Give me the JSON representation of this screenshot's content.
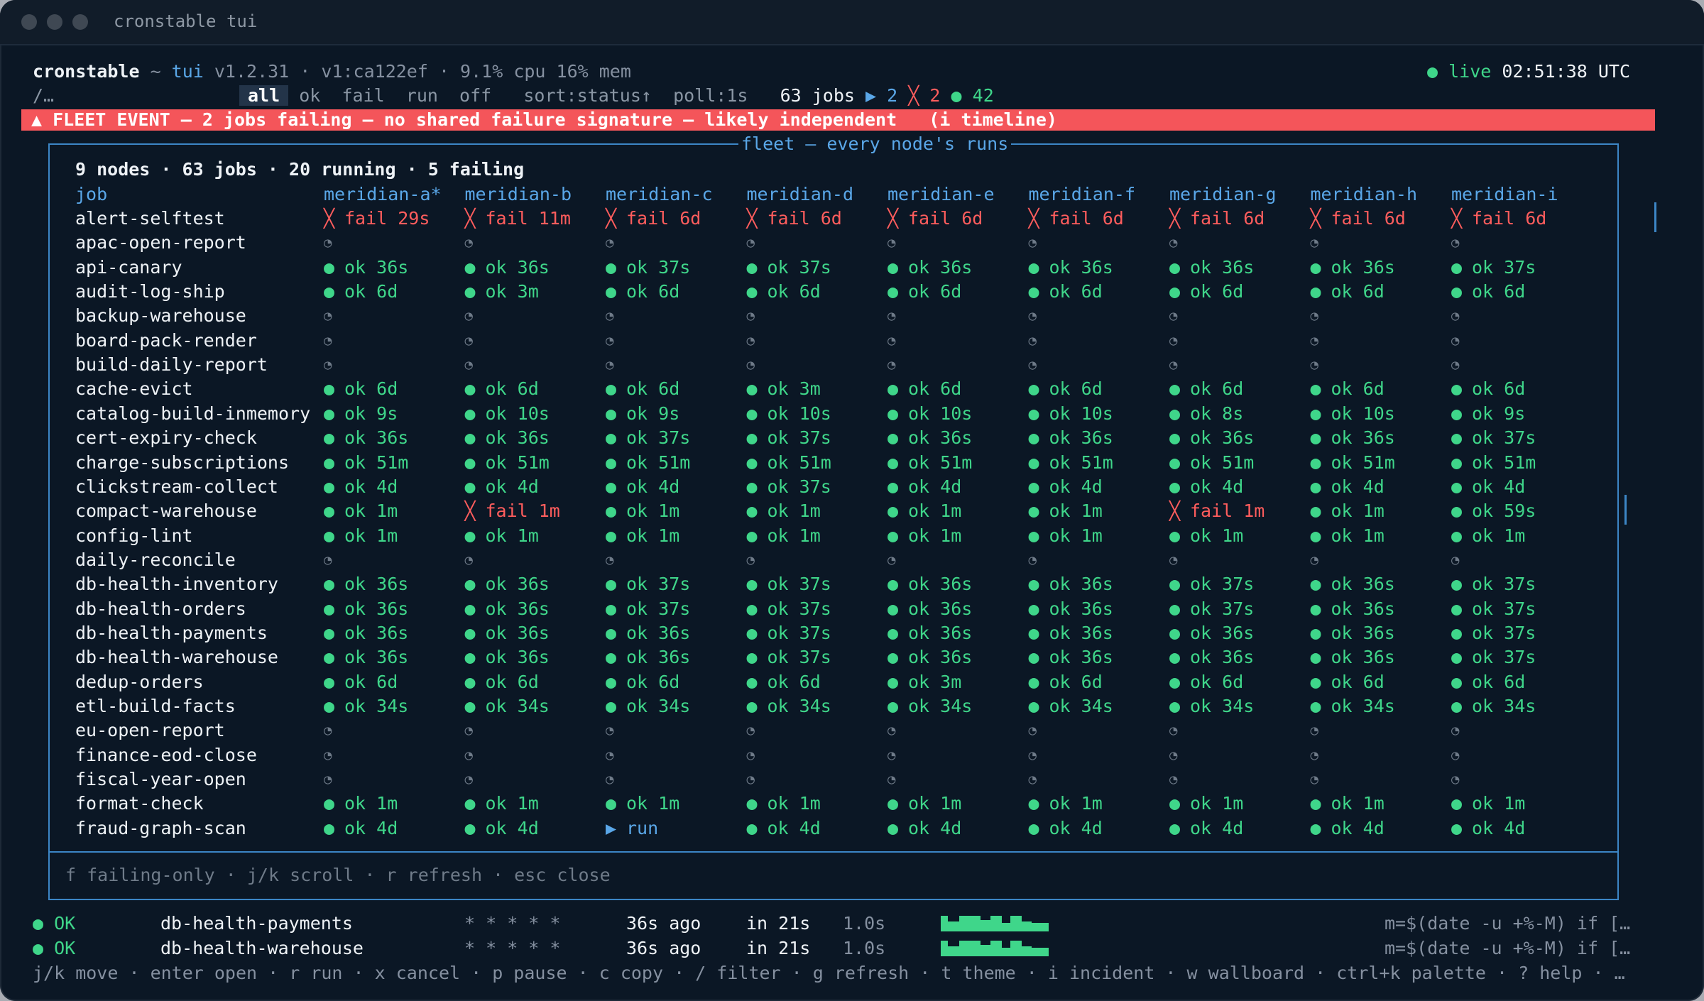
{
  "window": {
    "title": "cronstable tui"
  },
  "header": {
    "app": "cronstable",
    "sep": " ~ ",
    "mode": "tui",
    "meta": " v1.2.31 · v1:ca122ef · 9.1% cpu 16% mem",
    "live_label": "live",
    "clock": "02:51:38 UTC",
    "path": "/…",
    "filters": [
      "all",
      "ok",
      "fail",
      "run",
      "off"
    ],
    "active_filter": "all",
    "sort": "sort:status↑",
    "poll": "poll:1s",
    "jobs_count": "63 jobs",
    "run_count": "2",
    "fail_count": "2",
    "ok_count": "42"
  },
  "banner": {
    "text": "▲ FLEET EVENT — 2 jobs failing — no shared failure signature — likely independent   (i timeline)"
  },
  "fleet": {
    "title": "fleet — every node's runs",
    "summary": "9 nodes · 63 jobs · 20 running · 5 failing",
    "job_header": "job",
    "nodes": [
      "meridian-a*",
      "meridian-b",
      "meridian-c",
      "meridian-d",
      "meridian-e",
      "meridian-f",
      "meridian-g",
      "meridian-h",
      "meridian-i"
    ],
    "rows": [
      {
        "job": "alert-selftest",
        "cells": [
          [
            "fail",
            "fail 29s"
          ],
          [
            "fail",
            "fail 11m"
          ],
          [
            "fail",
            "fail 6d"
          ],
          [
            "fail",
            "fail 6d"
          ],
          [
            "fail",
            "fail 6d"
          ],
          [
            "fail",
            "fail 6d"
          ],
          [
            "fail",
            "fail 6d"
          ],
          [
            "fail",
            "fail 6d"
          ],
          [
            "fail",
            "fail 6d"
          ]
        ]
      },
      {
        "job": "apac-open-report",
        "cells": [
          [
            "idle",
            ""
          ],
          [
            "idle",
            ""
          ],
          [
            "idle",
            ""
          ],
          [
            "idle",
            ""
          ],
          [
            "idle",
            ""
          ],
          [
            "idle",
            ""
          ],
          [
            "idle",
            ""
          ],
          [
            "idle",
            ""
          ],
          [
            "idle",
            ""
          ]
        ]
      },
      {
        "job": "api-canary",
        "cells": [
          [
            "ok",
            "ok 36s"
          ],
          [
            "ok",
            "ok 36s"
          ],
          [
            "ok",
            "ok 37s"
          ],
          [
            "ok",
            "ok 37s"
          ],
          [
            "ok",
            "ok 36s"
          ],
          [
            "ok",
            "ok 36s"
          ],
          [
            "ok",
            "ok 36s"
          ],
          [
            "ok",
            "ok 36s"
          ],
          [
            "ok",
            "ok 37s"
          ]
        ]
      },
      {
        "job": "audit-log-ship",
        "cells": [
          [
            "ok",
            "ok 6d"
          ],
          [
            "ok",
            "ok 3m"
          ],
          [
            "ok",
            "ok 6d"
          ],
          [
            "ok",
            "ok 6d"
          ],
          [
            "ok",
            "ok 6d"
          ],
          [
            "ok",
            "ok 6d"
          ],
          [
            "ok",
            "ok 6d"
          ],
          [
            "ok",
            "ok 6d"
          ],
          [
            "ok",
            "ok 6d"
          ]
        ]
      },
      {
        "job": "backup-warehouse",
        "cells": [
          [
            "idle",
            ""
          ],
          [
            "idle",
            ""
          ],
          [
            "idle",
            ""
          ],
          [
            "idle",
            ""
          ],
          [
            "idle",
            ""
          ],
          [
            "idle",
            ""
          ],
          [
            "idle",
            ""
          ],
          [
            "idle",
            ""
          ],
          [
            "idle",
            ""
          ]
        ]
      },
      {
        "job": "board-pack-render",
        "cells": [
          [
            "idle",
            ""
          ],
          [
            "idle",
            ""
          ],
          [
            "idle",
            ""
          ],
          [
            "idle",
            ""
          ],
          [
            "idle",
            ""
          ],
          [
            "idle",
            ""
          ],
          [
            "idle",
            ""
          ],
          [
            "idle",
            ""
          ],
          [
            "idle",
            ""
          ]
        ]
      },
      {
        "job": "build-daily-report",
        "cells": [
          [
            "idle",
            ""
          ],
          [
            "idle",
            ""
          ],
          [
            "idle",
            ""
          ],
          [
            "idle",
            ""
          ],
          [
            "idle",
            ""
          ],
          [
            "idle",
            ""
          ],
          [
            "idle",
            ""
          ],
          [
            "idle",
            ""
          ],
          [
            "idle",
            ""
          ]
        ]
      },
      {
        "job": "cache-evict",
        "cells": [
          [
            "ok",
            "ok 6d"
          ],
          [
            "ok",
            "ok 6d"
          ],
          [
            "ok",
            "ok 6d"
          ],
          [
            "ok",
            "ok 3m"
          ],
          [
            "ok",
            "ok 6d"
          ],
          [
            "ok",
            "ok 6d"
          ],
          [
            "ok",
            "ok 6d"
          ],
          [
            "ok",
            "ok 6d"
          ],
          [
            "ok",
            "ok 6d"
          ]
        ]
      },
      {
        "job": "catalog-build-inmemory",
        "cells": [
          [
            "ok",
            "ok 9s"
          ],
          [
            "ok",
            "ok 10s"
          ],
          [
            "ok",
            "ok 9s"
          ],
          [
            "ok",
            "ok 10s"
          ],
          [
            "ok",
            "ok 10s"
          ],
          [
            "ok",
            "ok 10s"
          ],
          [
            "ok",
            "ok 8s"
          ],
          [
            "ok",
            "ok 10s"
          ],
          [
            "ok",
            "ok 9s"
          ]
        ]
      },
      {
        "job": "cert-expiry-check",
        "cells": [
          [
            "ok",
            "ok 36s"
          ],
          [
            "ok",
            "ok 36s"
          ],
          [
            "ok",
            "ok 37s"
          ],
          [
            "ok",
            "ok 37s"
          ],
          [
            "ok",
            "ok 36s"
          ],
          [
            "ok",
            "ok 36s"
          ],
          [
            "ok",
            "ok 36s"
          ],
          [
            "ok",
            "ok 36s"
          ],
          [
            "ok",
            "ok 37s"
          ]
        ]
      },
      {
        "job": "charge-subscriptions",
        "cells": [
          [
            "ok",
            "ok 51m"
          ],
          [
            "ok",
            "ok 51m"
          ],
          [
            "ok",
            "ok 51m"
          ],
          [
            "ok",
            "ok 51m"
          ],
          [
            "ok",
            "ok 51m"
          ],
          [
            "ok",
            "ok 51m"
          ],
          [
            "ok",
            "ok 51m"
          ],
          [
            "ok",
            "ok 51m"
          ],
          [
            "ok",
            "ok 51m"
          ]
        ]
      },
      {
        "job": "clickstream-collect",
        "cells": [
          [
            "ok",
            "ok 4d"
          ],
          [
            "ok",
            "ok 4d"
          ],
          [
            "ok",
            "ok 4d"
          ],
          [
            "ok",
            "ok 37s"
          ],
          [
            "ok",
            "ok 4d"
          ],
          [
            "ok",
            "ok 4d"
          ],
          [
            "ok",
            "ok 4d"
          ],
          [
            "ok",
            "ok 4d"
          ],
          [
            "ok",
            "ok 4d"
          ]
        ]
      },
      {
        "job": "compact-warehouse",
        "cells": [
          [
            "ok",
            "ok 1m"
          ],
          [
            "fail",
            "fail 1m"
          ],
          [
            "ok",
            "ok 1m"
          ],
          [
            "ok",
            "ok 1m"
          ],
          [
            "ok",
            "ok 1m"
          ],
          [
            "ok",
            "ok 1m"
          ],
          [
            "fail",
            "fail 1m"
          ],
          [
            "ok",
            "ok 1m"
          ],
          [
            "ok",
            "ok 59s"
          ]
        ]
      },
      {
        "job": "config-lint",
        "cells": [
          [
            "ok",
            "ok 1m"
          ],
          [
            "ok",
            "ok 1m"
          ],
          [
            "ok",
            "ok 1m"
          ],
          [
            "ok",
            "ok 1m"
          ],
          [
            "ok",
            "ok 1m"
          ],
          [
            "ok",
            "ok 1m"
          ],
          [
            "ok",
            "ok 1m"
          ],
          [
            "ok",
            "ok 1m"
          ],
          [
            "ok",
            "ok 1m"
          ]
        ]
      },
      {
        "job": "daily-reconcile",
        "cells": [
          [
            "idle",
            ""
          ],
          [
            "idle",
            ""
          ],
          [
            "idle",
            ""
          ],
          [
            "idle",
            ""
          ],
          [
            "idle",
            ""
          ],
          [
            "idle",
            ""
          ],
          [
            "idle",
            ""
          ],
          [
            "idle",
            ""
          ],
          [
            "idle",
            ""
          ]
        ]
      },
      {
        "job": "db-health-inventory",
        "cells": [
          [
            "ok",
            "ok 36s"
          ],
          [
            "ok",
            "ok 36s"
          ],
          [
            "ok",
            "ok 37s"
          ],
          [
            "ok",
            "ok 37s"
          ],
          [
            "ok",
            "ok 36s"
          ],
          [
            "ok",
            "ok 36s"
          ],
          [
            "ok",
            "ok 37s"
          ],
          [
            "ok",
            "ok 36s"
          ],
          [
            "ok",
            "ok 37s"
          ]
        ]
      },
      {
        "job": "db-health-orders",
        "cells": [
          [
            "ok",
            "ok 36s"
          ],
          [
            "ok",
            "ok 36s"
          ],
          [
            "ok",
            "ok 37s"
          ],
          [
            "ok",
            "ok 37s"
          ],
          [
            "ok",
            "ok 36s"
          ],
          [
            "ok",
            "ok 36s"
          ],
          [
            "ok",
            "ok 37s"
          ],
          [
            "ok",
            "ok 36s"
          ],
          [
            "ok",
            "ok 37s"
          ]
        ]
      },
      {
        "job": "db-health-payments",
        "cells": [
          [
            "ok",
            "ok 36s"
          ],
          [
            "ok",
            "ok 36s"
          ],
          [
            "ok",
            "ok 36s"
          ],
          [
            "ok",
            "ok 37s"
          ],
          [
            "ok",
            "ok 36s"
          ],
          [
            "ok",
            "ok 36s"
          ],
          [
            "ok",
            "ok 36s"
          ],
          [
            "ok",
            "ok 36s"
          ],
          [
            "ok",
            "ok 37s"
          ]
        ]
      },
      {
        "job": "db-health-warehouse",
        "cells": [
          [
            "ok",
            "ok 36s"
          ],
          [
            "ok",
            "ok 36s"
          ],
          [
            "ok",
            "ok 36s"
          ],
          [
            "ok",
            "ok 37s"
          ],
          [
            "ok",
            "ok 36s"
          ],
          [
            "ok",
            "ok 36s"
          ],
          [
            "ok",
            "ok 36s"
          ],
          [
            "ok",
            "ok 36s"
          ],
          [
            "ok",
            "ok 37s"
          ]
        ]
      },
      {
        "job": "dedup-orders",
        "cells": [
          [
            "ok",
            "ok 6d"
          ],
          [
            "ok",
            "ok 6d"
          ],
          [
            "ok",
            "ok 6d"
          ],
          [
            "ok",
            "ok 6d"
          ],
          [
            "ok",
            "ok 3m"
          ],
          [
            "ok",
            "ok 6d"
          ],
          [
            "ok",
            "ok 6d"
          ],
          [
            "ok",
            "ok 6d"
          ],
          [
            "ok",
            "ok 6d"
          ]
        ]
      },
      {
        "job": "etl-build-facts",
        "cells": [
          [
            "ok",
            "ok 34s"
          ],
          [
            "ok",
            "ok 34s"
          ],
          [
            "ok",
            "ok 34s"
          ],
          [
            "ok",
            "ok 34s"
          ],
          [
            "ok",
            "ok 34s"
          ],
          [
            "ok",
            "ok 34s"
          ],
          [
            "ok",
            "ok 34s"
          ],
          [
            "ok",
            "ok 34s"
          ],
          [
            "ok",
            "ok 34s"
          ]
        ]
      },
      {
        "job": "eu-open-report",
        "cells": [
          [
            "idle",
            ""
          ],
          [
            "idle",
            ""
          ],
          [
            "idle",
            ""
          ],
          [
            "idle",
            ""
          ],
          [
            "idle",
            ""
          ],
          [
            "idle",
            ""
          ],
          [
            "idle",
            ""
          ],
          [
            "idle",
            ""
          ],
          [
            "idle",
            ""
          ]
        ]
      },
      {
        "job": "finance-eod-close",
        "cells": [
          [
            "idle",
            ""
          ],
          [
            "idle",
            ""
          ],
          [
            "idle",
            ""
          ],
          [
            "idle",
            ""
          ],
          [
            "idle",
            ""
          ],
          [
            "idle",
            ""
          ],
          [
            "idle",
            ""
          ],
          [
            "idle",
            ""
          ],
          [
            "idle",
            ""
          ]
        ]
      },
      {
        "job": "fiscal-year-open",
        "cells": [
          [
            "idle",
            ""
          ],
          [
            "idle",
            ""
          ],
          [
            "idle",
            ""
          ],
          [
            "idle",
            ""
          ],
          [
            "idle",
            ""
          ],
          [
            "idle",
            ""
          ],
          [
            "idle",
            ""
          ],
          [
            "idle",
            ""
          ],
          [
            "idle",
            ""
          ]
        ]
      },
      {
        "job": "format-check",
        "cells": [
          [
            "ok",
            "ok 1m"
          ],
          [
            "ok",
            "ok 1m"
          ],
          [
            "ok",
            "ok 1m"
          ],
          [
            "ok",
            "ok 1m"
          ],
          [
            "ok",
            "ok 1m"
          ],
          [
            "ok",
            "ok 1m"
          ],
          [
            "ok",
            "ok 1m"
          ],
          [
            "ok",
            "ok 1m"
          ],
          [
            "ok",
            "ok 1m"
          ]
        ]
      },
      {
        "job": "fraud-graph-scan",
        "cells": [
          [
            "ok",
            "ok 4d"
          ],
          [
            "ok",
            "ok 4d"
          ],
          [
            "run",
            "run"
          ],
          [
            "ok",
            "ok 4d"
          ],
          [
            "ok",
            "ok 4d"
          ],
          [
            "ok",
            "ok 4d"
          ],
          [
            "ok",
            "ok 4d"
          ],
          [
            "ok",
            "ok 4d"
          ],
          [
            "ok",
            "ok 4d"
          ]
        ]
      }
    ],
    "footer": "f failing-only · j/k scroll · r refresh · esc close"
  },
  "joblist": [
    {
      "status": "OK",
      "name": "db-health-payments",
      "schedule": "* * * * *",
      "last": "36s ago",
      "next": "in 21s",
      "dur": "1.0s",
      "cmd": "m=$(date -u +%-M) if […"
    },
    {
      "status": "OK",
      "name": "db-health-warehouse",
      "schedule": "* * * * *",
      "last": "36s ago",
      "next": "in 21s",
      "dur": "1.0s",
      "cmd": "m=$(date -u +%-M) if […"
    }
  ],
  "keybar": "j/k move · enter open · r run · x cancel · p pause · c copy · / filter · g refresh · t theme · i incident · w wallboard · ctrl+k palette · ? help · …",
  "colors": {
    "ok": "#3fd68a",
    "fail": "#ff5d5d",
    "run": "#5aa7e8",
    "border": "#3c86c6",
    "banner": "#f4555a",
    "bg": "#0b1725"
  },
  "icons": {
    "ok": "dot-icon",
    "fail": "cross-icon",
    "run": "play-icon",
    "idle": "clock-icon",
    "live": "live-dot-icon"
  }
}
